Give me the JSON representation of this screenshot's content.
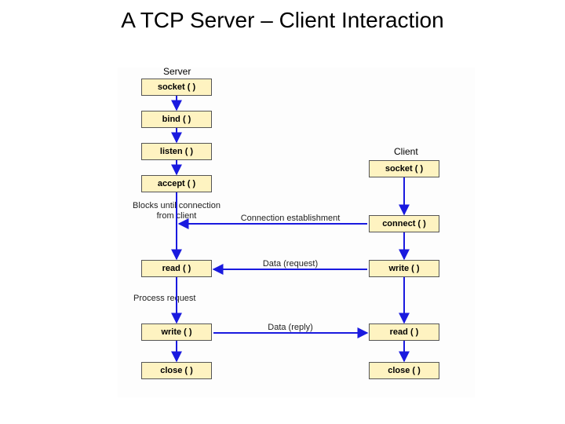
{
  "title": "A TCP Server – Client Interaction",
  "headers": {
    "server": "Server",
    "client": "Client"
  },
  "server_boxes": {
    "socket": "socket ( )",
    "bind": "bind ( )",
    "listen": "listen ( )",
    "accept": "accept ( )",
    "read": "read ( )",
    "write": "write ( )",
    "close": "close ( )"
  },
  "client_boxes": {
    "socket": "socket ( )",
    "connect": "connect ( )",
    "write": "write ( )",
    "read": "read ( )",
    "close": "close ( )"
  },
  "notes": {
    "blocks": "Blocks until connection\nfrom client",
    "process": "Process request"
  },
  "edge_labels": {
    "establish": "Connection establishment",
    "request": "Data (request)",
    "reply": "Data (reply)"
  },
  "colors": {
    "box_fill": "#fef3c1",
    "box_border": "#555555",
    "arrow": "#1a1adf"
  }
}
